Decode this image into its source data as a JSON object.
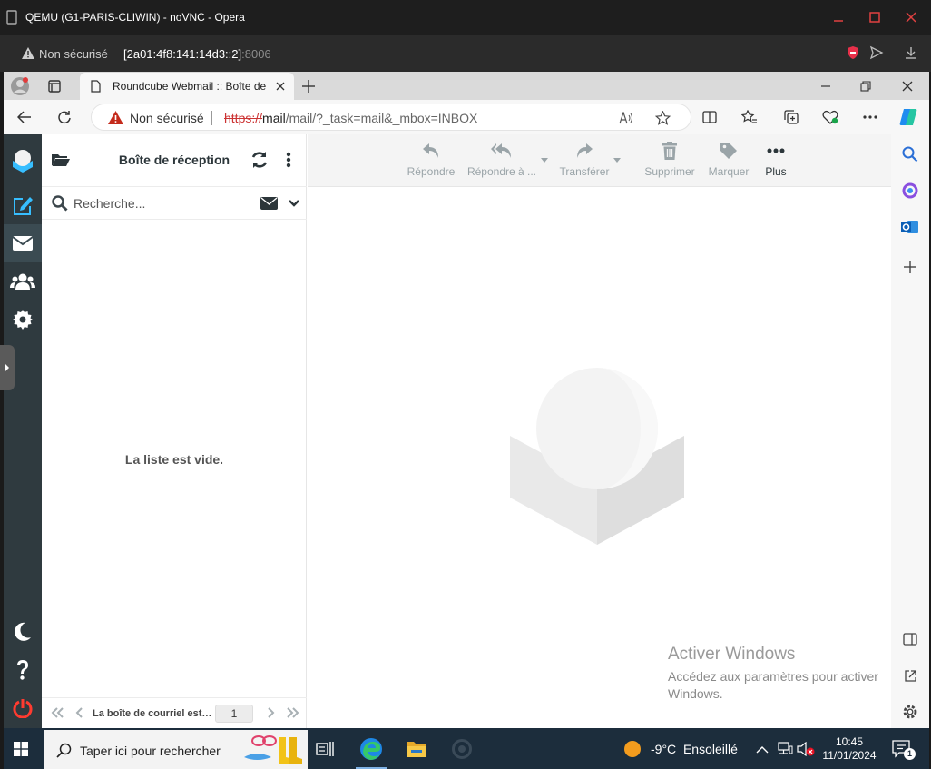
{
  "opera": {
    "window_title": "QEMU (G1-PARIS-CLIWIN) - noVNC - Opera",
    "security_label": "Non sécurisé",
    "address_host": "[2a01:4f8:141:14d3::2]",
    "address_port": ":8006"
  },
  "edge": {
    "tab_title": "Roundcube Webmail :: Boîte de réception",
    "security_label": "Non sécurisé",
    "url_scheme": "https://",
    "url_host": "mail",
    "url_path": "/mail/?_task=mail&_mbox=INBOX"
  },
  "roundcube": {
    "mailbox_title": "Boîte de réception",
    "search_placeholder": "Recherche...",
    "empty_message": "La liste est vide.",
    "pager_text": "La boîte de courriel est vide",
    "page_number": "1",
    "toolbar": {
      "reply": "Répondre",
      "reply_all": "Répondre à ...",
      "forward": "Transférer",
      "delete": "Supprimer",
      "mark": "Marquer",
      "more": "Plus"
    },
    "watermark_title": "Activer Windows",
    "watermark_text": "Accédez aux paramètres pour activer Windows."
  },
  "taskbar": {
    "search_text": "Taper ici pour rechercher",
    "temperature": "-9°C",
    "weather": "Ensoleillé",
    "time": "10:45",
    "date": "11/01/2024",
    "notification_count": "1"
  },
  "colors": {
    "nav_bg": "#2f3a3f",
    "accent_blue": "#37beff",
    "logout_red": "#ff3b30",
    "taskbar_bg": "#1c2d3c"
  }
}
